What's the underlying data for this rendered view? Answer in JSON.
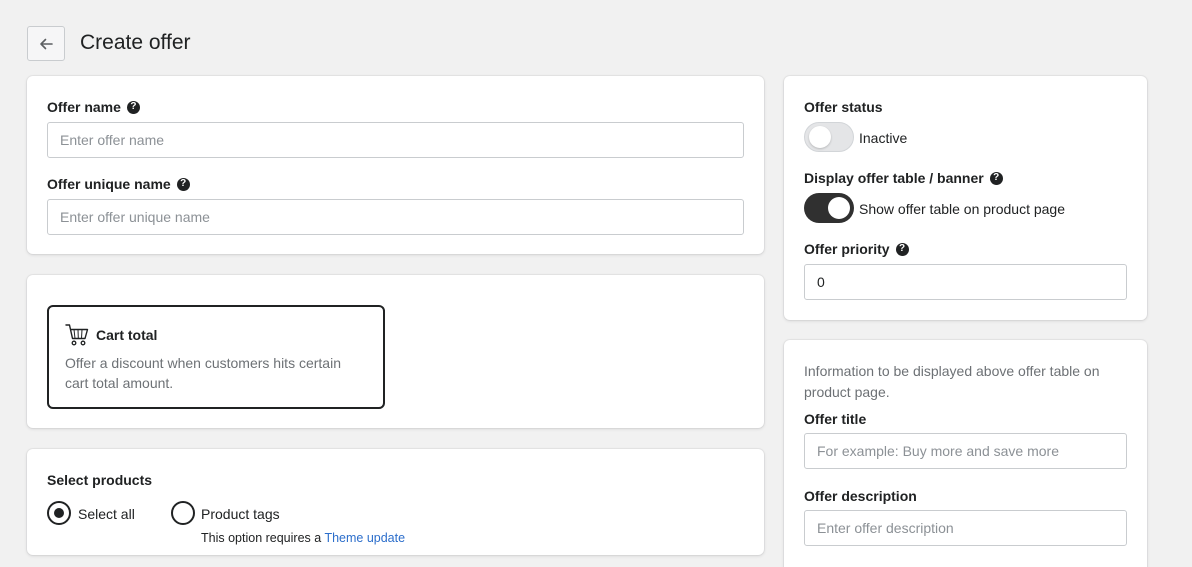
{
  "header": {
    "title": "Create offer",
    "back_icon": "arrow-left-icon"
  },
  "offer_details": {
    "name_label": "Offer name",
    "name_placeholder": "Enter offer name",
    "name_value": "",
    "unique_name_label": "Offer unique name",
    "unique_name_placeholder": "Enter offer unique name",
    "unique_name_value": ""
  },
  "offer_type": {
    "icon": "cart-icon",
    "title": "Cart total",
    "description": "Offer a discount when customers hits certain cart total amount."
  },
  "products": {
    "label": "Select products",
    "options": [
      {
        "label": "Select all",
        "selected": true
      },
      {
        "label": "Product tags",
        "selected": false
      }
    ],
    "note_prefix": "This option requires a",
    "note_link": "Theme update"
  },
  "status": {
    "status_label": "Offer status",
    "status_toggle_text": "Inactive",
    "status_on": false,
    "display_label": "Display offer table / banner",
    "display_toggle_text": "Show offer table on product page",
    "display_on": true,
    "priority_label": "Offer priority",
    "priority_value": "0"
  },
  "display_info": {
    "info": "Information to be displayed above offer table on product page.",
    "title_label": "Offer title",
    "title_placeholder": "For example: Buy more and save more",
    "title_value": "",
    "description_label": "Offer description",
    "description_placeholder": "Enter offer description",
    "description_value": ""
  },
  "colors": {
    "background": "#f1f1f1",
    "card": "#ffffff",
    "text": "#202223",
    "subdued": "#6d7175",
    "link": "#2c6ecb",
    "toggle_on": "#303030"
  }
}
